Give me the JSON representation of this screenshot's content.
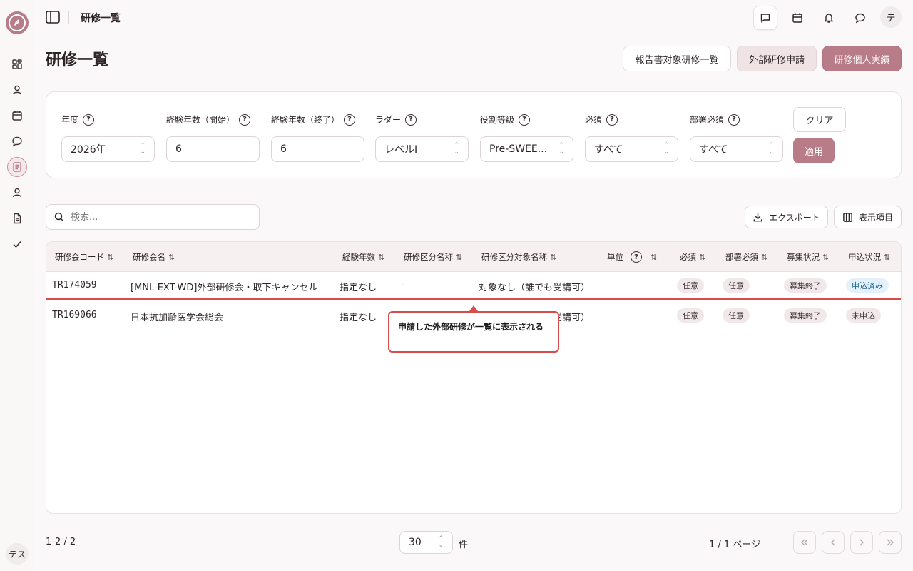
{
  "topbar": {
    "title": "研修一覧",
    "avatar": "テ"
  },
  "sidebar": {
    "user_avatar": "テス"
  },
  "page": {
    "title": "研修一覧"
  },
  "header_buttons": {
    "report_list": "報告書対象研修一覧",
    "external_apply": "外部研修申請",
    "personal_record": "研修個人実績"
  },
  "filters": {
    "year": {
      "label": "年度",
      "value": "2026年"
    },
    "exp_start": {
      "label": "経験年数（開始）",
      "value": "6"
    },
    "exp_end": {
      "label": "経験年数（終了）",
      "value": "6"
    },
    "ladder": {
      "label": "ラダー",
      "value": "レベルI"
    },
    "role_grade": {
      "label": "役割等級",
      "value": "Pre-SWEE..."
    },
    "required": {
      "label": "必須",
      "value": "すべて"
    },
    "dept_required": {
      "label": "部署必須",
      "value": "すべて"
    },
    "clear": "クリア",
    "apply": "適用"
  },
  "toolbar": {
    "search_placeholder": "検索...",
    "export": "エクスポート",
    "columns": "表示項目"
  },
  "table": {
    "headers": {
      "code": "研修会コード",
      "name": "研修会名",
      "experience": "経験年数",
      "category": "研修区分名称",
      "category_target": "研修区分対象名称",
      "unit": "単位",
      "required": "必須",
      "dept_required": "部署必須",
      "recruit": "募集状況",
      "apply_status": "申込状況"
    },
    "rows": [
      {
        "code": "TR174059",
        "name": "[MNL-EXT-WD]外部研修会・取下キャンセル",
        "experience": "指定なし",
        "category": "-",
        "category_target": "対象なし（誰でも受講可）",
        "unit": "–",
        "required": "任意",
        "dept_required": "任意",
        "recruit": "募集終了",
        "apply_status": "申込済み"
      },
      {
        "code": "TR169066",
        "name": "日本抗加齢医学会総会",
        "experience": "指定なし",
        "category": "-",
        "category_target": "対象なし（誰でも受講可）",
        "unit": "–",
        "required": "任意",
        "dept_required": "任意",
        "recruit": "募集終了",
        "apply_status": "未申込"
      }
    ]
  },
  "callout": {
    "text": "申請した外部研修が一覧に表示される"
  },
  "pagination": {
    "count": "1-2 / 2",
    "page_size": "30",
    "unit": "件",
    "page_info": "1 / 1 ページ"
  }
}
